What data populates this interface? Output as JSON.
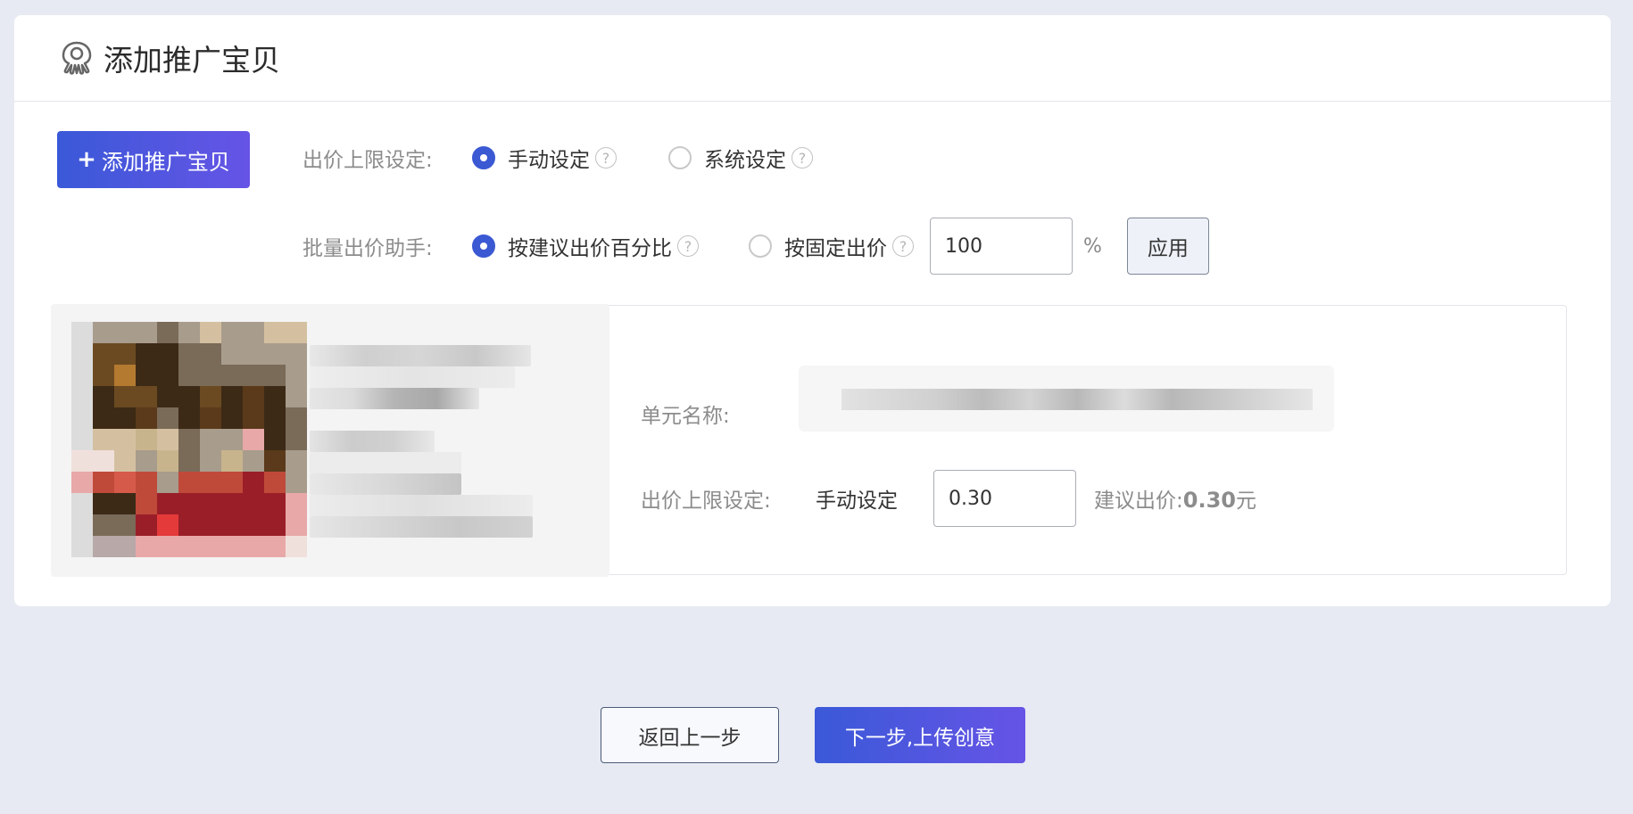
{
  "header": {
    "title": "添加推广宝贝",
    "icon": "octopus-logo-icon"
  },
  "toolbar": {
    "add_button_label": "添加推广宝贝",
    "bid_limit": {
      "label": "出价上限设定:",
      "options": [
        {
          "label": "手动设定",
          "checked": true
        },
        {
          "label": "系统设定",
          "checked": false
        }
      ]
    },
    "batch_bid": {
      "label": "批量出价助手:",
      "options": [
        {
          "label": "按建议出价百分比",
          "checked": true
        },
        {
          "label": "按固定出价",
          "checked": false
        }
      ],
      "input_value": "100",
      "unit": "%",
      "apply_label": "应用"
    },
    "help_glyph": "?"
  },
  "unit": {
    "name_label": "单元名称:",
    "bid_limit_label": "出价上限设定:",
    "bid_limit_mode": "手动设定",
    "bid_input_value": "0.30",
    "suggest_label": "建议出价:",
    "suggest_value": "0.30",
    "suggest_unit": "元"
  },
  "footer": {
    "back_label": "返回上一步",
    "next_label": "下一步,上传创意"
  },
  "colors": {
    "primary": "#3b59d3",
    "gradient_end": "#6654e6",
    "background": "#e7eaf2"
  }
}
